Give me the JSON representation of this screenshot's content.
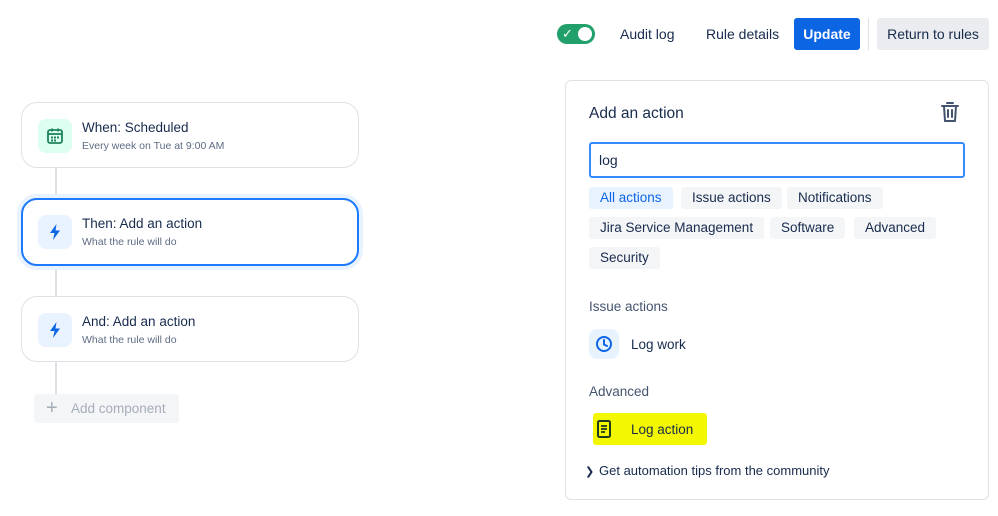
{
  "toolbar": {
    "toggle_state": "on",
    "audit_log": "Audit log",
    "rule_details": "Rule details",
    "update": "Update",
    "return_to_rules": "Return to rules"
  },
  "flow": {
    "trigger": {
      "title": "When: Scheduled",
      "subtitle": "Every week on Tue at 9:00 AM",
      "icon": "calendar-icon"
    },
    "action1": {
      "title": "Then: Add an action",
      "subtitle": "What the rule will do",
      "icon": "lightning-icon"
    },
    "action2": {
      "title": "And: Add an action",
      "subtitle": "What the rule will do",
      "icon": "lightning-icon"
    },
    "add_component": "Add component"
  },
  "panel": {
    "title": "Add an action",
    "search_value": "log",
    "filters": [
      "All actions",
      "Issue actions",
      "Notifications",
      "Jira Service Management",
      "Software",
      "Advanced",
      "Security"
    ],
    "active_filter": "All actions",
    "sections": [
      {
        "heading": "Issue actions",
        "items": [
          {
            "label": "Log work",
            "icon": "clock-icon"
          }
        ]
      },
      {
        "heading": "Advanced",
        "items": [
          {
            "label": "Log action",
            "icon": "document-icon"
          }
        ]
      }
    ],
    "tips": "Get automation tips from the community"
  },
  "colors": {
    "primary": "#0c66e4",
    "toggle_on": "#22a06b",
    "highlight": "#f3f700",
    "selected_border": "#1d7afc"
  }
}
